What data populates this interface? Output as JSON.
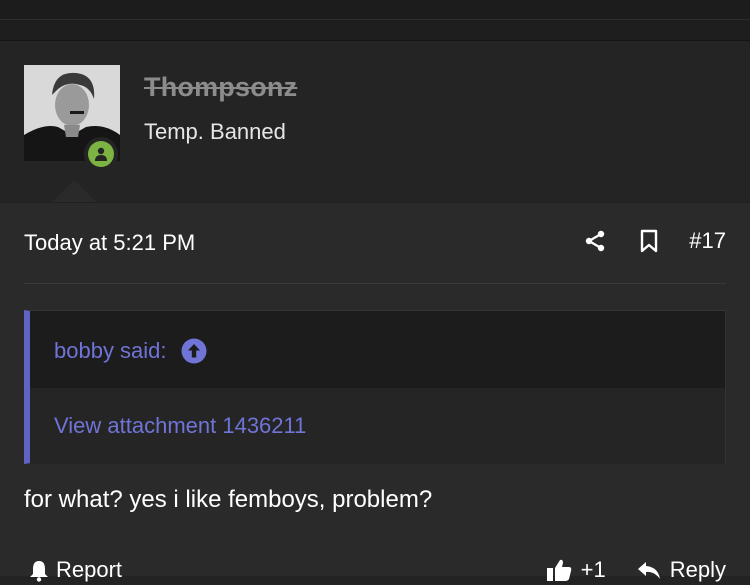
{
  "user": {
    "name": "Thompsonz",
    "title": "Temp. Banned",
    "status_icon": "user-online-icon",
    "status_color": "#7cb342"
  },
  "post": {
    "timestamp": "Today at 5:21 PM",
    "number": "#17",
    "share_icon": "share-icon",
    "bookmark_icon": "bookmark-icon",
    "quote": {
      "author": "bobby said:",
      "jump_icon": "arrow-up-circle-icon",
      "content": "View attachment 1436211"
    },
    "body": "for what? yes i like femboys, problem?",
    "footer": {
      "report_label": "Report",
      "like_label": "+1",
      "reply_label": "Reply"
    }
  },
  "colors": {
    "accent": "#6f74d6",
    "quote_border": "#5f63c6",
    "background": "#2a2a2a"
  }
}
